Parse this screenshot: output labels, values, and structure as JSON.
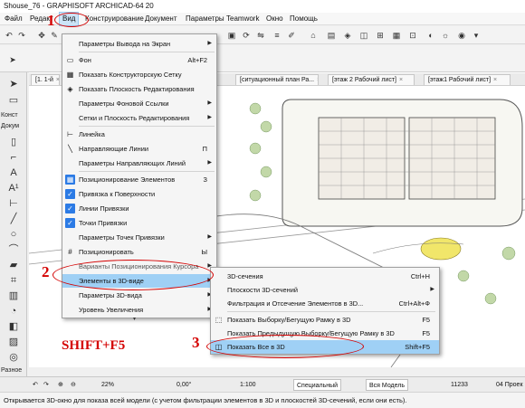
{
  "title": "Shouse_76 - GRAPHISOFT ARCHICAD-64 20",
  "menubar": [
    "Файл",
    "Редакт",
    "Вид",
    "Конструирование",
    "Документ",
    "Параметры",
    "Teamwork",
    "Окно",
    "Помощь"
  ],
  "toolbox_labels": {
    "construct": "Конст",
    "document": "Докум",
    "more": "Разное"
  },
  "tabs": [
    "[1. 1-й",
    "[ситуационный план Ра...",
    "[этаж 2 Рабочий лист]",
    "[этаж1 Рабочий лист]"
  ],
  "view_menu": {
    "items": [
      {
        "label": "Параметры Вывода на Экран",
        "shortcut": "",
        "submenu": true
      },
      {
        "label": "Фон",
        "shortcut": "Alt+F2",
        "icon": "background-icon"
      },
      {
        "label": "Показать Конструкторскую Сетку",
        "shortcut": "",
        "icon": "grid-icon"
      },
      {
        "label": "Показать Плоскость Редактирования",
        "shortcut": "",
        "icon": "plane-icon"
      },
      {
        "label": "Параметры Фоновой Ссылки",
        "shortcut": "",
        "submenu": true
      },
      {
        "label": "Сетки и Плоскость Редактирования",
        "shortcut": "",
        "submenu": true
      },
      {
        "label": "Линейка",
        "shortcut": "",
        "icon": "ruler-icon"
      },
      {
        "label": "Направляющие Линии",
        "shortcut": "Π",
        "icon": "guide-icon"
      },
      {
        "label": "Параметры Направляющих Линий",
        "shortcut": "",
        "submenu": true
      },
      {
        "label": "Позиционирование Элементов",
        "shortcut": "З",
        "icon": "position-icon"
      },
      {
        "label": "Привязка к Поверхности",
        "shortcut": "",
        "icon": "check-icon"
      },
      {
        "label": "Линии Привязки",
        "shortcut": "",
        "icon": "snap-lines-icon"
      },
      {
        "label": "Точки Привязки",
        "shortcut": "",
        "icon": "check-icon"
      },
      {
        "label": "Параметры Точек Привязки",
        "shortcut": "",
        "submenu": true
      },
      {
        "label": "Позиционировать",
        "shortcut": "Ы",
        "icon": "hash-icon"
      },
      {
        "label": "Варианты Позиционирования Курсора",
        "shortcut": "",
        "submenu": true
      },
      {
        "label": "Элементы в 3D-виде",
        "shortcut": "",
        "submenu": true
      },
      {
        "label": "Параметры 3D-вида",
        "shortcut": "",
        "submenu": true
      },
      {
        "label": "Уровень Увеличения",
        "shortcut": "",
        "submenu": true
      }
    ],
    "more": "▾"
  },
  "sub_menu": {
    "items": [
      {
        "label": "3D-сечения",
        "shortcut": "Ctrl+H"
      },
      {
        "label": "Плоскости 3D-сечений",
        "shortcut": "",
        "submenu": true
      },
      {
        "label": "Фильтрация и Отсечение Элементов в 3D...",
        "shortcut": "Ctrl+Alt+Ф"
      },
      {
        "label": "Показать Выборку/Бегущую Рамку в 3D",
        "shortcut": "F5"
      },
      {
        "label": "Показать Предыдущую Выборку/Бегущую Рамку в 3D",
        "shortcut": "F5"
      },
      {
        "label": "Показать Все в 3D",
        "shortcut": "Shift+F5"
      }
    ]
  },
  "annotations": {
    "step1": "1",
    "step2": "2",
    "step3": "3",
    "hint": "SHIFT+F5"
  },
  "statusbar": {
    "zoom": "22%",
    "angle": "0,00°",
    "scale": "1:100",
    "special": "Специальный",
    "model": "Вся Модель",
    "count": "11233",
    "sheet": "04 Проек"
  },
  "status_text": "Открывается 3D-окно для показа всей модели (с учетом фильтрации элементов в 3D и плоскостей 3D-сечений, если они есть).",
  "colors": {
    "menu_highlight": "#cfe6fb",
    "annotation_red": "#d40000",
    "check_blue": "#2c7be5"
  }
}
